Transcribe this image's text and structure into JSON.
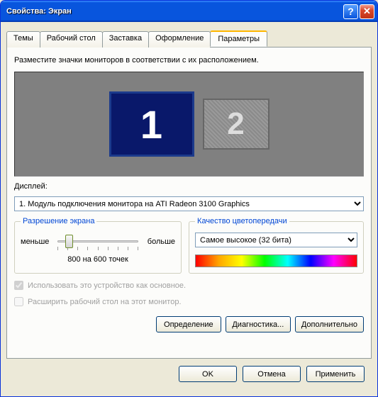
{
  "window": {
    "title": "Свойства: Экран"
  },
  "tabs": {
    "t0": "Темы",
    "t1": "Рабочий стол",
    "t2": "Заставка",
    "t3": "Оформление",
    "t4": "Параметры"
  },
  "instruction": "Разместите значки мониторов в соответствии с их расположением.",
  "monitors": {
    "m1": "1",
    "m2": "2"
  },
  "display": {
    "label": "Дисплей:",
    "value": "1. Модуль подключения монитора на ATI Radeon 3100 Graphics"
  },
  "resolution": {
    "legend": "Разрешение экрана",
    "less": "меньше",
    "more": "больше",
    "value": "800 на 600 точек"
  },
  "quality": {
    "legend": "Качество цветопередачи",
    "value": "Самое высокое (32 бита)"
  },
  "checks": {
    "primary": "Использовать это устройство как основное.",
    "extend": "Расширить рабочий стол на этот монитор."
  },
  "actions": {
    "identify": "Определение",
    "troubleshoot": "Диагностика...",
    "advanced": "Дополнительно"
  },
  "footer": {
    "ok": "OK",
    "cancel": "Отмена",
    "apply": "Применить"
  }
}
